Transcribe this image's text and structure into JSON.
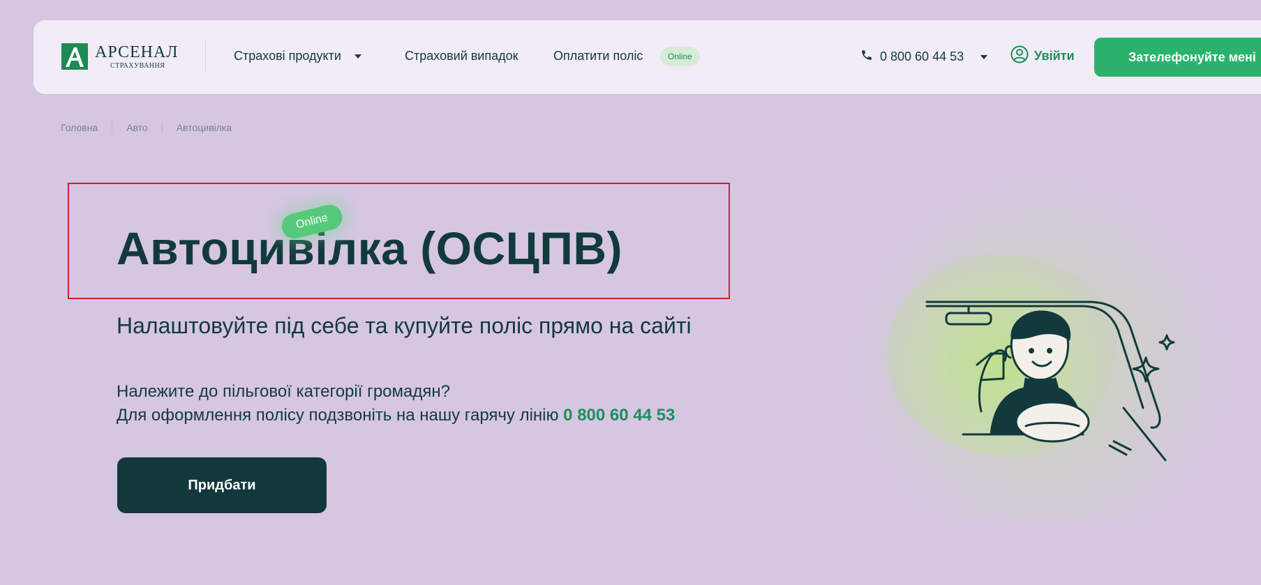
{
  "header": {
    "logo": {
      "name": "АРСЕНАЛ",
      "subtitle": "СТРАХУВАННЯ"
    },
    "nav": {
      "products_label": "Страхові продукти",
      "insured_event_label": "Страховий випадок",
      "pay_policy_label": "Оплатити поліс",
      "online_badge": "Online"
    },
    "phone": "0 800 60 44 53",
    "login_label": "Увійти",
    "call_me_label": "Зателефонуйте мені"
  },
  "breadcrumb": {
    "items": [
      "Головна",
      "Авто",
      "Автоцивілка"
    ]
  },
  "hero": {
    "badge": "Online",
    "title": "Автоцивілка (ОСЦПВ)",
    "subtitle": "Налаштовуйте під себе та купуйте поліс прямо на сайті",
    "note_line1": "Належите до пільгової категорії громадян?",
    "note_line2": "Для оформлення полісу подзвоніть на нашу гарячу лінію",
    "note_phone": "0 800 60 44 53",
    "buy_label": "Придбати"
  },
  "colors": {
    "background": "#d6c6e2",
    "brand_green": "#2bb36e",
    "dark_teal": "#12383b",
    "highlight_red": "#d11f2a"
  }
}
